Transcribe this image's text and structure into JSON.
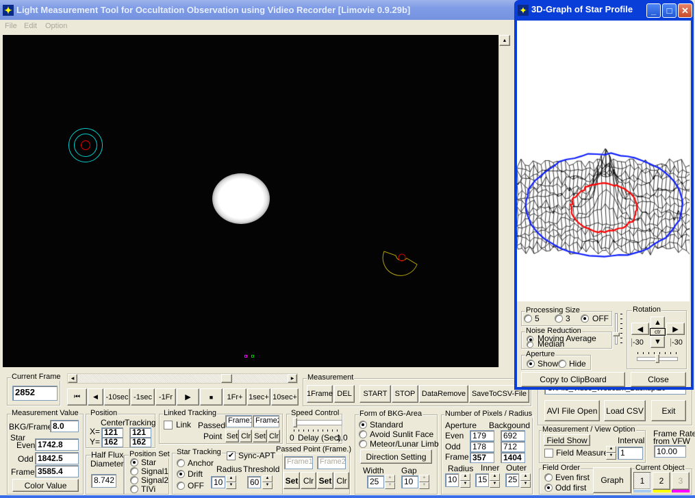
{
  "main_window": {
    "title": "Light Measurement Tool for Occultation Observation using Vidieo Recorder [Limovie 0.9.29b]",
    "menu": [
      "File",
      "Edit",
      "Option"
    ]
  },
  "current_frame": {
    "label": "Current Frame",
    "value": "2852"
  },
  "playback": {
    "first": "⏮",
    "prev": "◀",
    "minus10sec": "-10sec",
    "minus1sec": "-1sec",
    "minus1fr": "-1Fr",
    "play": "▶",
    "stop": "■",
    "plus1fr": "1Fr+",
    "plus1sec": "1sec+",
    "plus10sec": "10sec+"
  },
  "measurement": {
    "label": "Measurement",
    "buttons": [
      "1Frame",
      "DEL",
      "START",
      "STOP",
      "DataRemove",
      "SaveToCSV-File"
    ]
  },
  "measurement_value": {
    "label": "Measurement Value",
    "bkg_label": "BKG/Frame",
    "bkg": "8.0",
    "star_label": "Star",
    "even_label": "Even",
    "even": "1742.8",
    "odd_label": "Odd",
    "odd": "1842.5",
    "frame_label": "Frame",
    "frame": "3585.4",
    "color_button": "Color Value"
  },
  "position": {
    "label": "Position",
    "center": "Center",
    "tracking": "Tracking",
    "x_label": "X=",
    "y_label": "Y=",
    "center_x": "121",
    "center_y": "162",
    "tracking_x": "121",
    "tracking_y": "162"
  },
  "half_flux": {
    "label": "Half Flux",
    "label2": "Diameter",
    "value": "8.742"
  },
  "position_set": {
    "label": "Position Set",
    "options": [
      "Star",
      "Signal1",
      "Signal2",
      "TIVi"
    ],
    "selected": "Star"
  },
  "linked_tracking": {
    "label": "Linked Tracking",
    "link": "Link",
    "link_checked": false,
    "passed": "Passed-",
    "point": "Point",
    "frame1": "Frame1",
    "frame2": "Frame2",
    "set": "Set",
    "clr": "Clr"
  },
  "speed_control": {
    "label": "Speed Control",
    "min": "0",
    "caption": "Delay (Sec)",
    "max": "1.0",
    "value": 0
  },
  "star_tracking": {
    "label": "Star Tracking",
    "options": [
      "Anchor",
      "Drift",
      "OFF"
    ],
    "selected": "Drift",
    "sync_apt": "Sync-APT",
    "sync_checked": true,
    "radius_label": "Radius",
    "radius": "10",
    "threshold_label": "Threshold",
    "threshold": "60"
  },
  "passed_point": {
    "label": "Passed Point (Frame.)",
    "frame1": "Frame1",
    "frame2": "Frame2",
    "set": "Set",
    "clr": "Clr"
  },
  "bkg_area": {
    "label": "Form of BKG-Area",
    "options": [
      "Standard",
      "Avoid Sunlit Face",
      "Meteor/Lunar Limb"
    ],
    "selected": "Standard",
    "direction_button": "Direction Setting",
    "width_label": "Width",
    "width": "25",
    "gap_label": "Gap",
    "gap": "10"
  },
  "pixels": {
    "label": "Number of Pixels / Radius",
    "aperture": "Aperture",
    "background": "Backgound",
    "even_label": "Even",
    "odd_label": "Odd",
    "frame_label": "Frame",
    "even_ap": "179",
    "even_bg": "692",
    "odd_ap": "178",
    "odd_bg": "712",
    "frame_ap": "357",
    "frame_bg": "1404",
    "radius_label": "Radius",
    "radius": "10",
    "inner_label": "Inner",
    "inner": "15",
    "outer_label": "Outer",
    "outer": "25"
  },
  "file": {
    "path": "C:\\File_Video_Webcam_Backup\\20",
    "avi_open": "AVI File Open",
    "load_csv": "Load CSV",
    "exit": "Exit"
  },
  "view_option": {
    "label": "Measurement / View Option",
    "field_show": "Field Show",
    "interval_label": "Interval",
    "interval": "1",
    "field_measure": "Field Measure",
    "field_measure_checked": false
  },
  "frame_rate": {
    "label": "Frame Rate",
    "label2": "from VFW",
    "value": "10.00"
  },
  "field_order": {
    "label": "Field Order",
    "options": [
      "Even first",
      "Odd first"
    ],
    "selected": "Odd first"
  },
  "graph_button": "Graph",
  "current_object": {
    "label": "Current Object",
    "objects": [
      "1",
      "2",
      "3"
    ],
    "selected": "1",
    "colors": [
      "#a6caf0",
      "#ffff00",
      "#ff00ff"
    ]
  },
  "graph_window": {
    "title": "3D-Graph of Star Profile",
    "processing_size": {
      "label": "Processing Size",
      "options": [
        "5",
        "3",
        "OFF"
      ],
      "selected": "OFF"
    },
    "noise_reduction": {
      "label": "Noise Reduction",
      "options": [
        "Moving Average",
        "Median"
      ],
      "selected": "Moving Average"
    },
    "aperture": {
      "label": "Aperture",
      "options": [
        "Show",
        "Hide"
      ],
      "selected": "Show"
    },
    "rotation": {
      "label": "Rotation",
      "center": "ctr",
      "left_value": "-30",
      "right_value": "-30"
    },
    "copy_button": "Copy to ClipBoard",
    "close_button": "Close"
  },
  "colors": {
    "aperture_ring": "#ff0000",
    "background_ring": "#00e0e0",
    "object2": "#c0c000"
  }
}
